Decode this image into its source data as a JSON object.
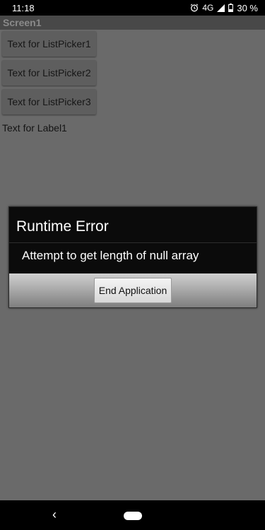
{
  "status_bar": {
    "time": "11:18",
    "network": "4G",
    "battery": "30 %",
    "icons": [
      "alarm-icon",
      "signal-icon",
      "battery-icon"
    ]
  },
  "title_bar": {
    "title": "Screen1"
  },
  "content": {
    "list_pickers": [
      {
        "label": "Text for ListPicker1"
      },
      {
        "label": "Text for ListPicker2"
      },
      {
        "label": "Text for ListPicker3"
      }
    ],
    "label1": "Text for Label1"
  },
  "dialog": {
    "title": "Runtime Error",
    "message": "Attempt to get length of null array",
    "button": "End Application"
  },
  "nav_bar": {
    "icons": [
      "back-icon",
      "home-pill-icon"
    ]
  }
}
